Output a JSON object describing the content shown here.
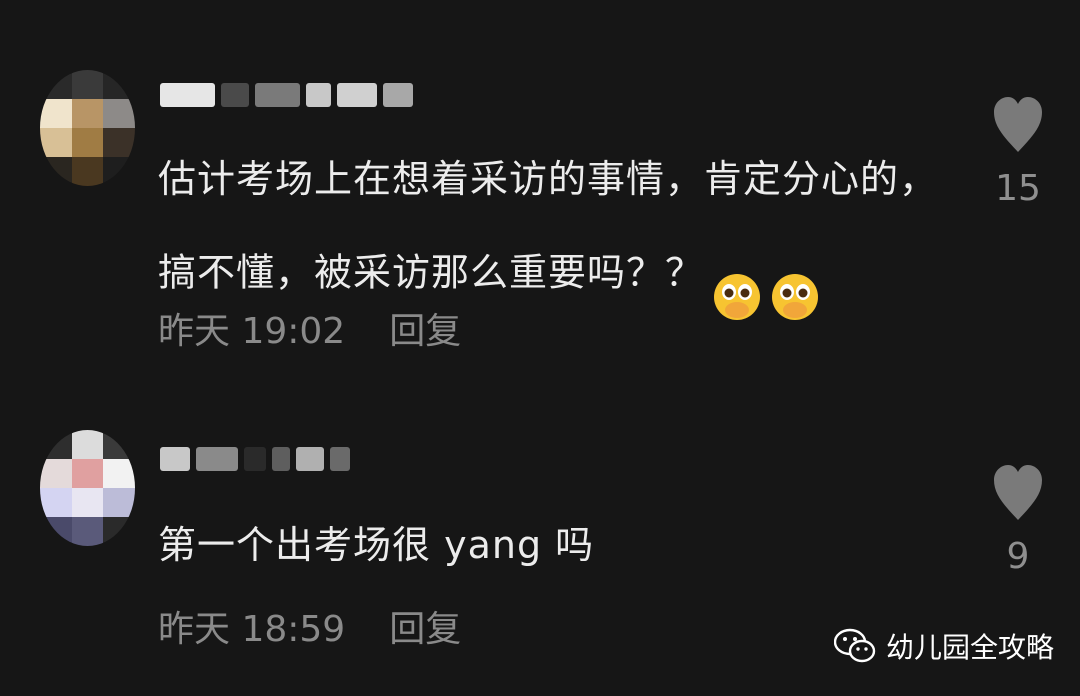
{
  "comments": [
    {
      "text": "估计考场上在想着采访的事情，肯定分心的，\n搞不懂，被采访那么重要吗？？",
      "emoji": "pleading-face-emoji",
      "time": "昨天 19:02",
      "reply_label": "回复",
      "likes": "15"
    },
    {
      "text": "第一个出考场很 yang 吗",
      "time": "昨天 18:59",
      "reply_label": "回复",
      "likes": "9"
    }
  ],
  "watermark": {
    "icon": "wechat-icon",
    "text": "幼儿园全攻略"
  },
  "colors": {
    "background": "#161616",
    "comment_text": "#ececec",
    "meta_text": "#8a8a8a",
    "like_icon": "#7a7a7a"
  }
}
